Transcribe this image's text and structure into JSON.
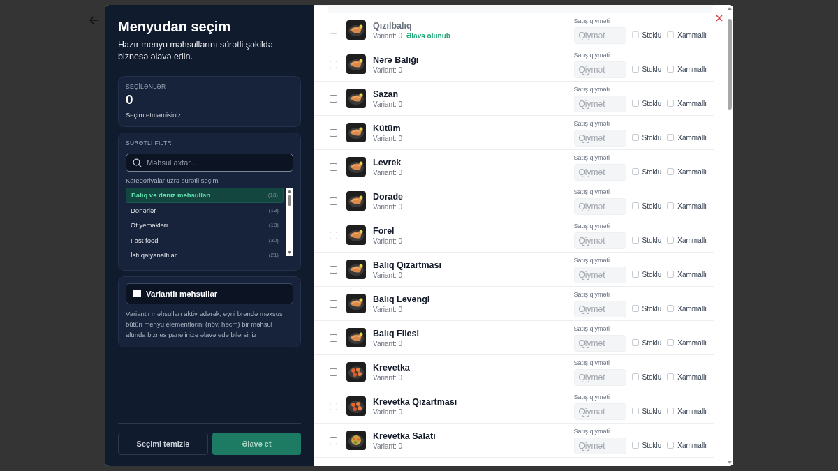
{
  "sidebar": {
    "title": "Menyudan seçim",
    "subtitle": "Hazır menyu məhsullarını sürətli şəkildə biznesə əlavə edin.",
    "selected_card": {
      "label": "SEÇİLƏNLƏR",
      "count": "0",
      "note": "Seçim etməmisiniz"
    },
    "filter_card": {
      "label": "SÜRƏTLİ FİLTR",
      "search": {
        "placeholder": "Məhsul axtar..."
      },
      "categories_label": "Kateqoriyalar üzrə sürətli seçim",
      "categories": [
        {
          "name": "Balıq və dəniz məhsulları",
          "count": "(18)",
          "selected": true
        },
        {
          "name": "Dönərlər",
          "count": "(13)",
          "selected": false
        },
        {
          "name": "Ət yeməkləri",
          "count": "(18)",
          "selected": false
        },
        {
          "name": "Fast food",
          "count": "(30)",
          "selected": false
        },
        {
          "name": "İsti qəlyanaltılar",
          "count": "(21)",
          "selected": false
        }
      ]
    },
    "variant_card": {
      "label": "Variantlı məhsullar",
      "checked": false,
      "description": "Variantlı məhsulları aktiv edərək, eyni brendə məxsus bütün menyu elementlərini (növ, həcm) bir məhsul altında biznes panelinizə əlavə edə bilərsiniz"
    },
    "buttons": [
      {
        "label": "Seçimi təmizlə",
        "kind": "secondary"
      },
      {
        "label": "Əlavə et",
        "kind": "primary"
      }
    ]
  },
  "products": [
    {
      "name": "Qızılbalıq",
      "variant": "Variant: 0",
      "added": true,
      "added_label": "Əlavə olunub",
      "checked": false,
      "price_label": "Satış qiyməti",
      "price_placeholder": "Qiymət",
      "stock_label": "Stoklu",
      "stock": false,
      "raw_label": "Xammallı",
      "raw": false
    },
    {
      "name": "Nərə Balığı",
      "variant": "Variant: 0",
      "added": false,
      "checked": false,
      "price_label": "Satış qiyməti",
      "price_placeholder": "Qiymət",
      "stock_label": "Stoklu",
      "stock": false,
      "raw_label": "Xammallı",
      "raw": false
    },
    {
      "name": "Sazan",
      "variant": "Variant: 0",
      "added": false,
      "checked": false,
      "price_label": "Satış qiyməti",
      "price_placeholder": "Qiymət",
      "stock_label": "Stoklu",
      "stock": false,
      "raw_label": "Xammallı",
      "raw": false
    },
    {
      "name": "Kütüm",
      "variant": "Variant: 0",
      "added": false,
      "checked": false,
      "price_label": "Satış qiyməti",
      "price_placeholder": "Qiymət",
      "stock_label": "Stoklu",
      "stock": false,
      "raw_label": "Xammallı",
      "raw": false
    },
    {
      "name": "Levrek",
      "variant": "Variant: 0",
      "added": false,
      "checked": false,
      "price_label": "Satış qiyməti",
      "price_placeholder": "Qiymət",
      "stock_label": "Stoklu",
      "stock": false,
      "raw_label": "Xammallı",
      "raw": false
    },
    {
      "name": "Dorade",
      "variant": "Variant: 0",
      "added": false,
      "checked": false,
      "price_label": "Satış qiyməti",
      "price_placeholder": "Qiymət",
      "stock_label": "Stoklu",
      "stock": false,
      "raw_label": "Xammallı",
      "raw": false
    },
    {
      "name": "Forel",
      "variant": "Variant: 0",
      "added": false,
      "checked": false,
      "price_label": "Satış qiyməti",
      "price_placeholder": "Qiymət",
      "stock_label": "Stoklu",
      "stock": false,
      "raw_label": "Xammallı",
      "raw": false
    },
    {
      "name": "Balıq Qızartması",
      "variant": "Variant: 0",
      "added": false,
      "checked": false,
      "price_label": "Satış qiyməti",
      "price_placeholder": "Qiymət",
      "stock_label": "Stoklu",
      "stock": false,
      "raw_label": "Xammallı",
      "raw": false
    },
    {
      "name": "Balıq Ləvəngi",
      "variant": "Variant: 0",
      "added": false,
      "checked": false,
      "price_label": "Satış qiyməti",
      "price_placeholder": "Qiymət",
      "stock_label": "Stoklu",
      "stock": false,
      "raw_label": "Xammallı",
      "raw": false
    },
    {
      "name": "Balıq Filesi",
      "variant": "Variant: 0",
      "added": false,
      "checked": false,
      "price_label": "Satış qiyməti",
      "price_placeholder": "Qiymət",
      "stock_label": "Stoklu",
      "stock": false,
      "raw_label": "Xammallı",
      "raw": false
    },
    {
      "name": "Krevetka",
      "variant": "Variant: 0",
      "added": false,
      "checked": false,
      "price_label": "Satış qiyməti",
      "price_placeholder": "Qiymət",
      "stock_label": "Stoklu",
      "stock": false,
      "raw_label": "Xammallı",
      "raw": false
    },
    {
      "name": "Krevetka Qızartması",
      "variant": "Variant: 0",
      "added": false,
      "checked": false,
      "price_label": "Satış qiyməti",
      "price_placeholder": "Qiymət",
      "stock_label": "Stoklu",
      "stock": false,
      "raw_label": "Xammallı",
      "raw": false
    },
    {
      "name": "Krevetka Salatı",
      "variant": "Variant: 0",
      "added": false,
      "checked": false,
      "price_label": "Satış qiyməti",
      "price_placeholder": "Qiymət",
      "stock_label": "Stoklu",
      "stock": false,
      "raw_label": "Xammallı",
      "raw": false
    }
  ]
}
